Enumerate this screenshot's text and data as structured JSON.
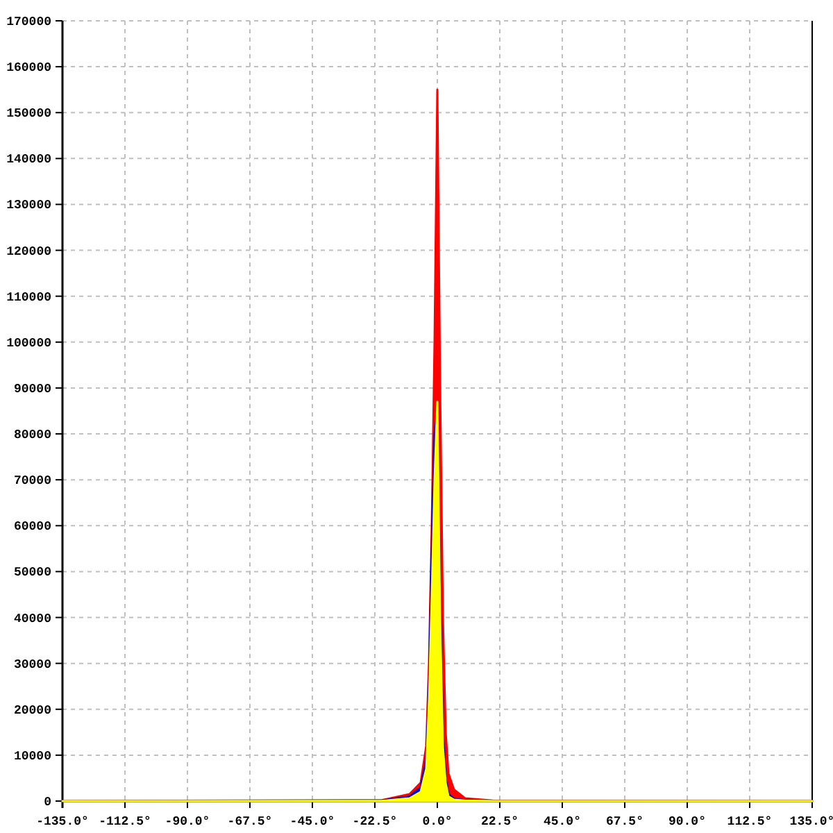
{
  "chart_data": {
    "type": "area",
    "grid": true,
    "x": [
      -135,
      -20,
      -10,
      -6,
      -4,
      -3,
      -2,
      -1,
      0,
      1,
      2,
      3,
      4,
      6,
      10,
      20,
      135
    ],
    "series": [
      {
        "color": "#ff0000",
        "values": [
          0,
          200,
          1500,
          4000,
          12000,
          30000,
          60000,
          100000,
          155000,
          90000,
          40000,
          15000,
          6000,
          2500,
          600,
          100,
          0
        ]
      },
      {
        "color": "#0000cc",
        "values": [
          0,
          100,
          1000,
          3000,
          9000,
          25000,
          55000,
          80000,
          85000,
          45000,
          15000,
          5000,
          1500,
          500,
          200,
          0,
          0
        ]
      },
      {
        "color": "#ffff00",
        "values": [
          0,
          50,
          600,
          2000,
          7000,
          22000,
          45000,
          70000,
          87000,
          40000,
          12000,
          4000,
          1000,
          300,
          100,
          0,
          0
        ]
      }
    ],
    "xlim": [
      -135,
      135
    ],
    "ylim": [
      0,
      170000
    ],
    "xticks": [
      {
        "value": -135,
        "label": "-135.0°"
      },
      {
        "value": -112.5,
        "label": "-112.5°"
      },
      {
        "value": -90,
        "label": "-90.0°"
      },
      {
        "value": -67.5,
        "label": "-67.5°"
      },
      {
        "value": -45,
        "label": "-45.0°"
      },
      {
        "value": -22.5,
        "label": "-22.5°"
      },
      {
        "value": 0,
        "label": "0.0°"
      },
      {
        "value": 22.5,
        "label": "22.5°"
      },
      {
        "value": 45,
        "label": "45.0°"
      },
      {
        "value": 67.5,
        "label": "67.5°"
      },
      {
        "value": 90,
        "label": "90.0°"
      },
      {
        "value": 112.5,
        "label": "112.5°"
      },
      {
        "value": 135,
        "label": "135.0°"
      }
    ],
    "yticks": [
      0,
      10000,
      20000,
      30000,
      40000,
      50000,
      60000,
      70000,
      80000,
      90000,
      100000,
      110000,
      120000,
      130000,
      140000,
      150000,
      160000,
      170000
    ]
  }
}
